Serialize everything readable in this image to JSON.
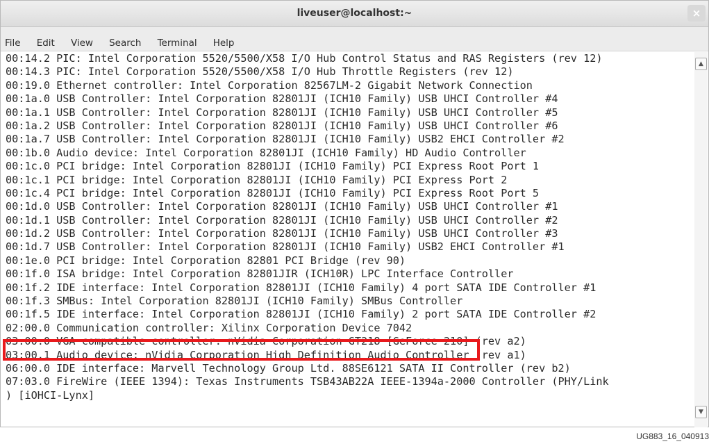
{
  "window": {
    "title": "liveuser@localhost:~",
    "close_icon_glyph": "×"
  },
  "menu": [
    {
      "label": "File"
    },
    {
      "label": "Edit"
    },
    {
      "label": "View"
    },
    {
      "label": "Search"
    },
    {
      "label": "Terminal"
    },
    {
      "label": "Help"
    }
  ],
  "terminal": {
    "lines": [
      "00:14.2 PIC: Intel Corporation 5520/5500/X58 I/O Hub Control Status and RAS Registers (rev 12)",
      "00:14.3 PIC: Intel Corporation 5520/5500/X58 I/O Hub Throttle Registers (rev 12)",
      "00:19.0 Ethernet controller: Intel Corporation 82567LM-2 Gigabit Network Connection",
      "00:1a.0 USB Controller: Intel Corporation 82801JI (ICH10 Family) USB UHCI Controller #4",
      "00:1a.1 USB Controller: Intel Corporation 82801JI (ICH10 Family) USB UHCI Controller #5",
      "00:1a.2 USB Controller: Intel Corporation 82801JI (ICH10 Family) USB UHCI Controller #6",
      "00:1a.7 USB Controller: Intel Corporation 82801JI (ICH10 Family) USB2 EHCI Controller #2",
      "00:1b.0 Audio device: Intel Corporation 82801JI (ICH10 Family) HD Audio Controller",
      "00:1c.0 PCI bridge: Intel Corporation 82801JI (ICH10 Family) PCI Express Root Port 1",
      "00:1c.1 PCI bridge: Intel Corporation 82801JI (ICH10 Family) PCI Express Port 2",
      "00:1c.4 PCI bridge: Intel Corporation 82801JI (ICH10 Family) PCI Express Root Port 5",
      "00:1d.0 USB Controller: Intel Corporation 82801JI (ICH10 Family) USB UHCI Controller #1",
      "00:1d.1 USB Controller: Intel Corporation 82801JI (ICH10 Family) USB UHCI Controller #2",
      "00:1d.2 USB Controller: Intel Corporation 82801JI (ICH10 Family) USB UHCI Controller #3",
      "00:1d.7 USB Controller: Intel Corporation 82801JI (ICH10 Family) USB2 EHCI Controller #1",
      "00:1e.0 PCI bridge: Intel Corporation 82801 PCI Bridge (rev 90)",
      "00:1f.0 ISA bridge: Intel Corporation 82801JIR (ICH10R) LPC Interface Controller",
      "00:1f.2 IDE interface: Intel Corporation 82801JI (ICH10 Family) 4 port SATA IDE Controller #1",
      "00:1f.3 SMBus: Intel Corporation 82801JI (ICH10 Family) SMBus Controller",
      "00:1f.5 IDE interface: Intel Corporation 82801JI (ICH10 Family) 2 port SATA IDE Controller #2",
      "02:00.0 Communication controller: Xilinx Corporation Device 7042",
      "03:00.0 VGA compatible controller: nVidia Corporation GT218 [GeForce 210] (rev a2)",
      "03:00.1 Audio device: nVidia Corporation High Definition Audio Controller (rev a1)",
      "06:00.0 IDE interface: Marvell Technology Group Ltd. 88SE6121 SATA II Controller (rev b2)",
      "07:03.0 FireWire (IEEE 1394): Texas Instruments TSB43AB22A IEEE-1394a-2000 Controller (PHY/Link",
      ") [iOHCI-Lynx]"
    ]
  },
  "annotation": {
    "highlight_color": "#e8191c"
  },
  "caption": "UG883_16_040913"
}
